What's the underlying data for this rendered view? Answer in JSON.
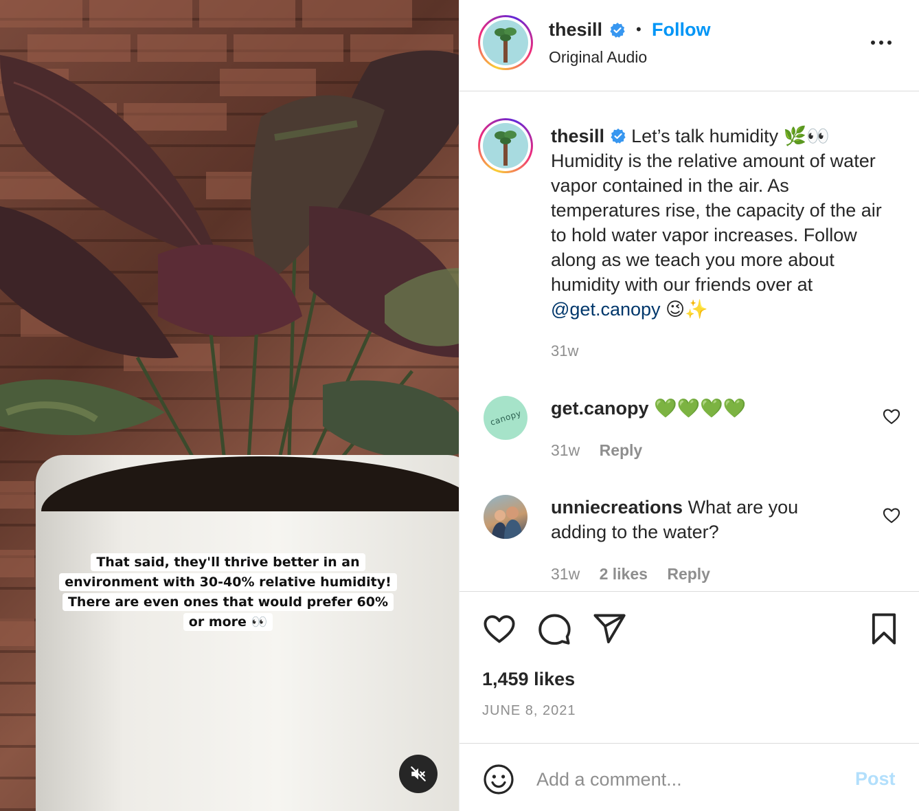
{
  "media": {
    "overlay_caption_lines": [
      "That said, they'll thrive better in an",
      "environment with 30-40% relative humidity!",
      "There are even ones that would prefer 60%",
      "or more 👀"
    ],
    "mute_icon": "speaker-muted-icon"
  },
  "header": {
    "username": "thesill",
    "verified": true,
    "separator": "•",
    "follow_label": "Follow",
    "audio_label": "Original Audio",
    "more_icon": "more-horizontal-icon"
  },
  "caption": {
    "username": "thesill",
    "text": "Let’s talk humidity 🌿👀 Humidity is the relative amount of water vapor contained in the air. As temperatures rise, the capacity of the air to hold water vapor increases. Follow along as we teach you more about humidity with our friends over at ",
    "mention": "@get.canopy",
    "emoji_tail": " 😉✨",
    "time": "31w"
  },
  "comments": [
    {
      "avatar_text": "canopy",
      "username": "get.canopy",
      "text": "💚💚💚💚",
      "time": "31w",
      "likes": "",
      "reply_label": "Reply"
    },
    {
      "username": "unniecreations",
      "text": "What are you adding to the water?",
      "time": "31w",
      "likes": "2 likes",
      "reply_label": "Reply"
    }
  ],
  "actions": {
    "like_icon": "heart-icon",
    "comment_icon": "comment-bubble-icon",
    "share_icon": "paper-plane-icon",
    "save_icon": "bookmark-icon",
    "likes_count": "1,459 likes",
    "date": "JUNE 8, 2021"
  },
  "comment_bar": {
    "emoji_icon": "smiley-icon",
    "placeholder": "Add a comment...",
    "post_label": "Post"
  },
  "colors": {
    "link_blue": "#0095f6",
    "mention_blue": "#00376b",
    "muted_gray": "#8e8e8e",
    "post_disabled": "#b2dffc",
    "verified_blue": "#3897f0"
  }
}
